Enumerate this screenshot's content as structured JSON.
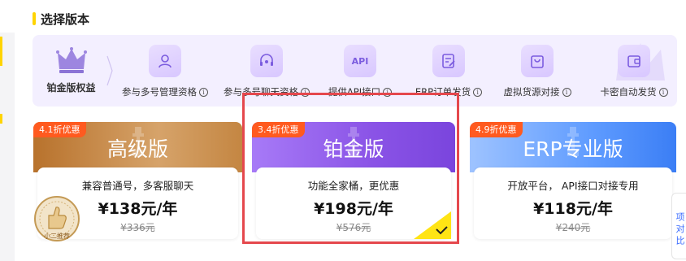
{
  "section": {
    "title": "选择版本"
  },
  "benefits": {
    "header_label": "铂金版权益",
    "items": [
      {
        "label": "参与多号管理资格",
        "icon": "user-group-icon"
      },
      {
        "label": "参与多号聊天资格",
        "icon": "headset-icon"
      },
      {
        "label": "提供API接口",
        "icon": "api-icon",
        "icon_text": "API"
      },
      {
        "label": "ERP订单发货",
        "icon": "order-edit-icon"
      },
      {
        "label": "虚拟货源对接",
        "icon": "shopping-bag-icon"
      },
      {
        "label": "卡密自动发货",
        "icon": "wallet-card-icon"
      }
    ]
  },
  "plans": [
    {
      "name": "高级版",
      "tag": "4.1折优惠",
      "desc": "兼容普通号，多客服聊天",
      "price": "¥138元/年",
      "original": "¥336元",
      "selected": false
    },
    {
      "name": "铂金版",
      "tag": "3.4折优惠",
      "desc": "功能全家桶，更优惠",
      "price": "¥198元/年",
      "original": "¥576元",
      "selected": true
    },
    {
      "name": "ERP专业版",
      "tag": "4.9折优惠",
      "desc": "开放平台， API接口对接专用",
      "price": "¥118元/年",
      "original": "¥240元",
      "selected": false
    }
  ],
  "seal": {
    "text": "小二推荐"
  },
  "right_tab": {
    "text": "项\n对\n比"
  },
  "colors": {
    "accent": "#ffd400",
    "selected_border": "#e5484d",
    "tag": "#ff5a1f"
  }
}
